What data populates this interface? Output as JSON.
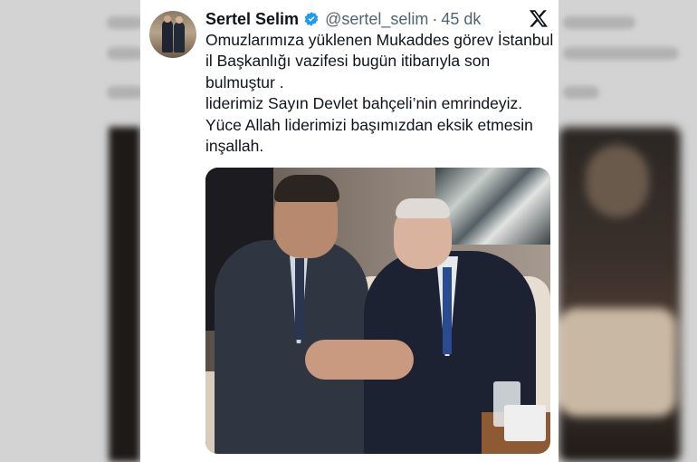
{
  "tweet": {
    "author_name": "Sertel Selim",
    "author_handle": "@sertel_selim",
    "separator": "·",
    "time_ago": "45 dk",
    "text_lines": [
      "Omuzlarımıza yüklenen Mukaddes görev İstanbul il Başkanlığı vazifesi bugün itibarıyla son bulmuştur .",
      "liderimiz Sayın Devlet bahçeli’nin emrindeyiz.",
      "Yüce Allah liderimizi başımızdan eksik etmesin inşallah."
    ]
  },
  "icons": {
    "verified": "verified-badge-icon",
    "platform": "x-logo-icon"
  },
  "colors": {
    "verified_blue": "#1d9bf0",
    "text_primary": "#0f1419",
    "text_secondary": "#536471"
  }
}
